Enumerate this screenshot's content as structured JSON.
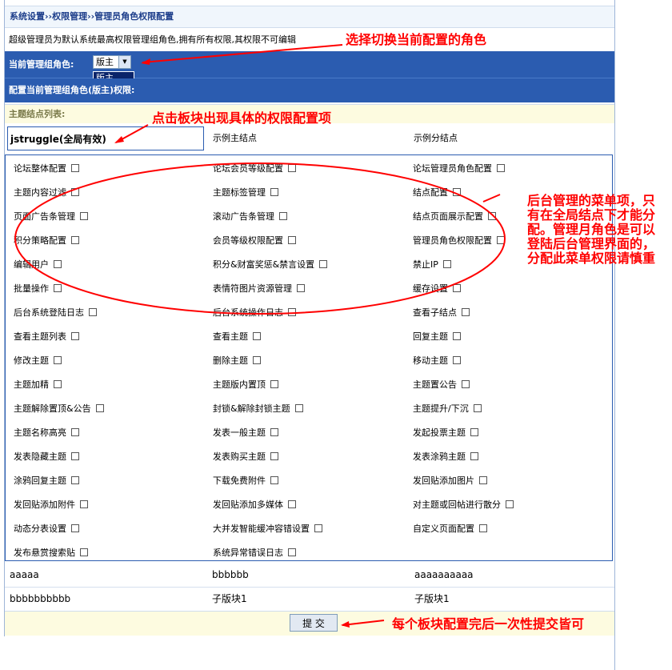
{
  "breadcrumb": "系统设置››权限管理››管理员角色权限配置",
  "notice": "超级管理员为默认系统最高权限管理组角色,拥有所有权限,其权限不可编辑",
  "role_label": "当前管理组角色:",
  "role_selected": "版主",
  "role_options": [
    "版主"
  ],
  "config_label": "配置当前管理组角色(版主)权限:",
  "tree_label": "主题结点列表:",
  "tabs": [
    "jstruggle(全局有效)",
    "示例主结点",
    "示例分结点"
  ],
  "permissions": [
    [
      "论坛整体配置",
      "论坛会员等级配置",
      "论坛管理员角色配置"
    ],
    [
      "主题内容过滤",
      "主题标签管理",
      "结点配置"
    ],
    [
      "页面广告条管理",
      "滚动广告条管理",
      "结点页面展示配置"
    ],
    [
      "积分策略配置",
      "会员等级权限配置",
      "管理员角色权限配置"
    ],
    [
      "编辑用户",
      "积分&财富奖惩&禁言设置",
      "禁止IP"
    ],
    [
      "批量操作",
      "表情符图片资源管理",
      "缓存设置"
    ],
    [
      "后台系统登陆日志",
      "后台系统操作日志",
      "查看子结点"
    ],
    [
      "查看主题列表",
      "查看主题",
      "回复主题"
    ],
    [
      "修改主题",
      "删除主题",
      "移动主题"
    ],
    [
      "主题加精",
      "主题版内置顶",
      "主题置公告"
    ],
    [
      "主题解除置顶&公告",
      "封锁&解除封锁主题",
      "主题提升/下沉"
    ],
    [
      "主题名称高亮",
      "发表一般主题",
      "发起投票主题"
    ],
    [
      "发表隐藏主题",
      "发表购买主题",
      "发表涂鸦主题"
    ],
    [
      "涂鸦回复主题",
      "下载免费附件",
      "发回贴添加图片"
    ],
    [
      "发回贴添加附件",
      "发回贴添加多媒体",
      "对主题或回帖进行散分"
    ],
    [
      "动态分表设置",
      "大并发智能缓冲容错设置",
      "自定义页面配置"
    ],
    [
      "发布悬赏搜索贴",
      "系统异常错误日志"
    ]
  ],
  "sub_rows": [
    [
      "aaaaa",
      "bbbbbb",
      "aaaaaaaaaa"
    ],
    [
      "bbbbbbbbbb",
      "子版块1",
      "子版块1"
    ]
  ],
  "submit_label": "提 交",
  "annotations": {
    "select_note": "选择切换当前配置的角色",
    "tab_note": "点击板块出现具体的权限配置项",
    "menu_note": "后台管理的菜单项，只有在全局结点下才能分配。管理月角色是可以登陆后台管理界面的，分配此菜单权限请慎重",
    "submit_note": "每个板块配置完后一次性提交皆可"
  },
  "colors": {
    "header_blue": "#2b5cb0",
    "annotation_red": "#ff0000",
    "tree_bg": "#fdfbe0"
  }
}
